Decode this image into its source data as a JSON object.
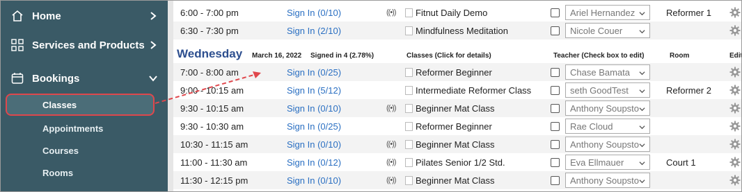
{
  "sidebar": {
    "items": [
      {
        "label": "Home",
        "icon": "home-icon"
      },
      {
        "label": "Services and Products",
        "icon": "grid-icon"
      },
      {
        "label": "Bookings",
        "icon": "calendar-icon"
      }
    ],
    "sub_items": [
      "Classes",
      "Appointments",
      "Courses",
      "Rooms"
    ]
  },
  "schedule": {
    "top_rows": [
      {
        "time": "6:00 - 7:00 pm",
        "signin": "Sign In (0/10)",
        "live": true,
        "class": "Fitnut Daily Demo",
        "teacher": "Ariel Hernandez",
        "room": "Reformer 1"
      },
      {
        "time": "6:30 - 7:30 pm",
        "signin": "Sign In (2/10)",
        "live": false,
        "class": "Mindfulness Meditation",
        "teacher": "Nicole Couer",
        "room": ""
      }
    ],
    "day_header": {
      "day": "Wednesday",
      "date": "March 16, 2022",
      "signed_in": "Signed in 4 (2.78%)",
      "classes_col": "Classes (Click for details)",
      "teacher_col": "Teacher (Check box to edit)",
      "room_col": "Room",
      "edit_col": "Edit"
    },
    "rows": [
      {
        "time": "7:00 - 8:00 am",
        "signin": "Sign In (0/25)",
        "live": false,
        "class": "Reformer Beginner",
        "teacher": "Chase Bamata",
        "room": ""
      },
      {
        "time": "9:00 - 10:15 am",
        "signin": "Sign In (5/12)",
        "live": false,
        "class": "Intermediate Reformer Class",
        "teacher": "seth GoodTest",
        "room": "Reformer 2"
      },
      {
        "time": "9:30 - 10:15 am",
        "signin": "Sign In (0/10)",
        "live": true,
        "class": "Beginner Mat Class",
        "teacher": "Anthony Soupsto",
        "room": ""
      },
      {
        "time": "9:30 - 10:30 am",
        "signin": "Sign In (0/25)",
        "live": false,
        "class": "Reformer Beginner",
        "teacher": "Rae Cloud",
        "room": ""
      },
      {
        "time": "10:30 - 11:15 am",
        "signin": "Sign In (0/10)",
        "live": true,
        "class": "Beginner Mat Class",
        "teacher": "Anthony Soupsto",
        "room": ""
      },
      {
        "time": "11:00 - 11:30 am",
        "signin": "Sign In (0/12)",
        "live": true,
        "class": "Pilates Senior 1/2 Std.",
        "teacher": "Eva Ellmauer",
        "room": "Court 1"
      },
      {
        "time": "11:30 - 12:15 pm",
        "signin": "Sign In (0/10)",
        "live": true,
        "class": "Beginner Mat Class",
        "teacher": "Anthony Soupsto",
        "room": ""
      }
    ],
    "live_glyph": "((•))"
  },
  "colors": {
    "sidebar": "#3a5a66",
    "highlight": "#e0474c",
    "link": "#2a6fc2",
    "day": "#2d4f8f"
  }
}
